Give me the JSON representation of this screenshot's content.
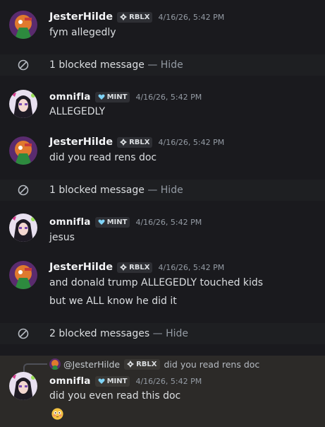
{
  "messages": [
    {
      "user": "JesterHilde",
      "tag": "RBLX",
      "timestamp": "4/16/26, 5:42 PM",
      "lines": [
        "fym allegedly"
      ]
    },
    {
      "user": "omnifla",
      "tag": "MINT",
      "timestamp": "4/16/26, 5:42 PM",
      "lines": [
        "ALLEGEDLY"
      ]
    },
    {
      "user": "JesterHilde",
      "tag": "RBLX",
      "timestamp": "4/16/26, 5:42 PM",
      "lines": [
        "did you read rens doc"
      ]
    },
    {
      "user": "omnifla",
      "tag": "MINT",
      "timestamp": "4/16/26, 5:42 PM",
      "lines": [
        "jesus"
      ]
    },
    {
      "user": "JesterHilde",
      "tag": "RBLX",
      "timestamp": "4/16/26, 5:42 PM",
      "lines": [
        "and donald trump ALLEGEDLY touched kids",
        "but we ALL know he did it"
      ]
    },
    {
      "user": "omnifla",
      "tag": "MINT",
      "timestamp": "4/16/26, 5:42 PM",
      "lines": [
        "did you even read this doc"
      ]
    }
  ],
  "blocked": [
    {
      "text": "1 blocked message",
      "sep": " — ",
      "action": "Hide"
    },
    {
      "text": "1 blocked message",
      "sep": " — ",
      "action": "Hide"
    },
    {
      "text": "2 blocked messages",
      "sep": " — ",
      "action": "Hide"
    }
  ],
  "reply": {
    "user": "@JesterHilde",
    "tag": "RBLX",
    "text": "did you read rens doc"
  },
  "icons": {
    "blocked": "blocked-circle-icon",
    "rblx_tag": "diamond-icon",
    "mint_tag": "heart-icon",
    "reaction": "flushed-face-emoji"
  },
  "colors": {
    "background": "#1a1a1e",
    "blocked_bg": "#1e1f22",
    "reply_highlight": "#2c2a28",
    "timestamp": "#949ba4",
    "mint_heart": "#7fd3f7"
  }
}
